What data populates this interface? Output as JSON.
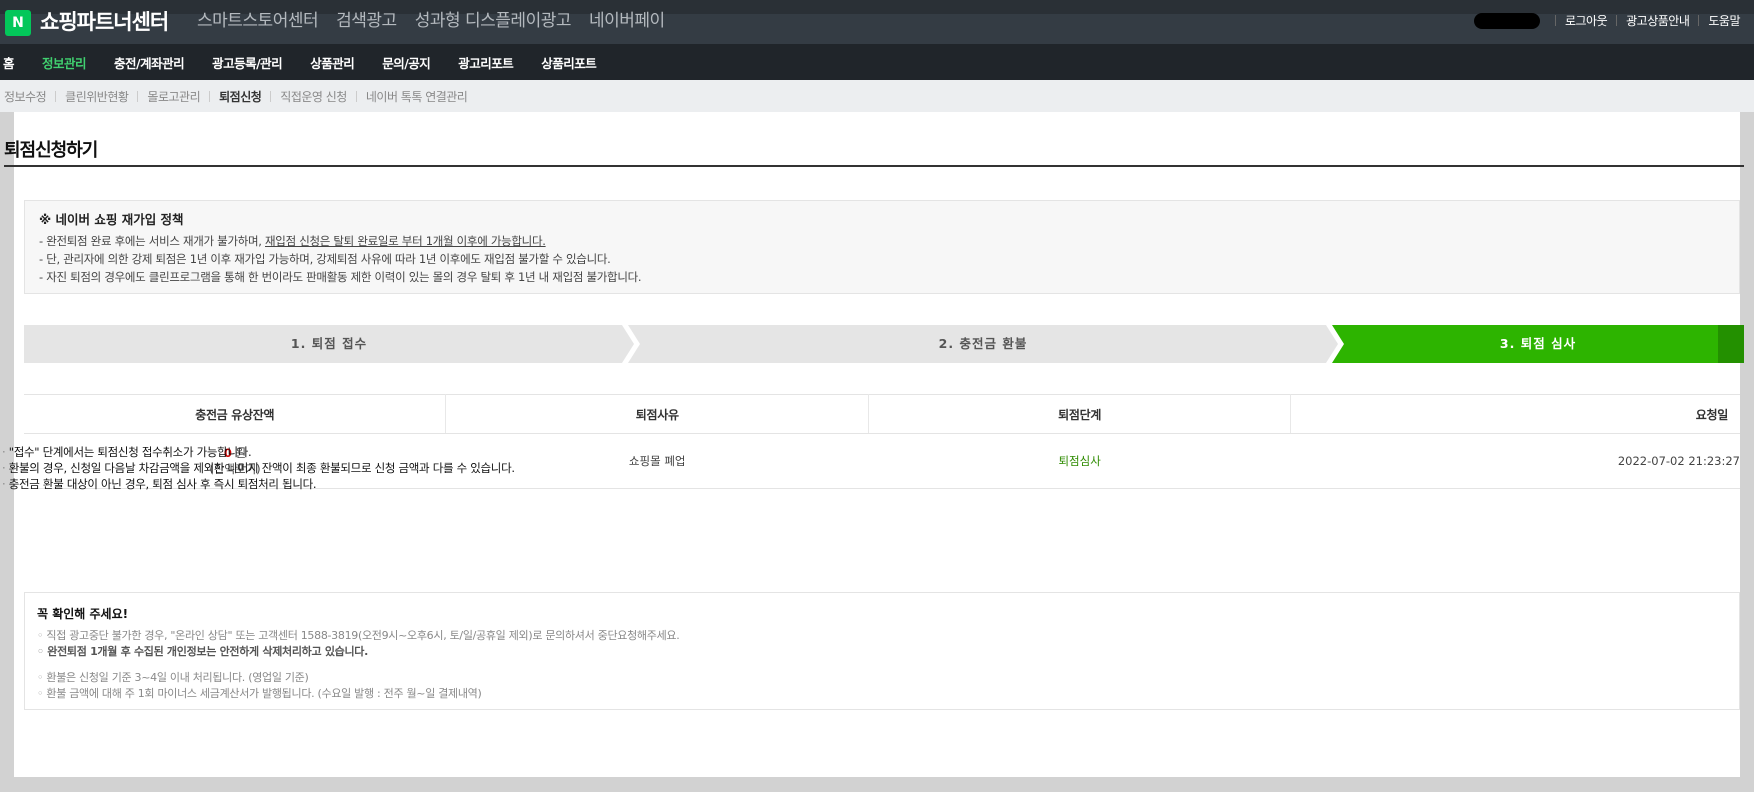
{
  "header": {
    "logo_letter": "N",
    "brand": "쇼핑파트너센터",
    "gnb": [
      "스마트스토어센터",
      "검색광고",
      "성과형 디스플레이광고",
      "네이버페이"
    ],
    "util": [
      "로그아웃",
      "광고상품안내",
      "도움말"
    ]
  },
  "mainnav": {
    "items": [
      "홈",
      "정보관리",
      "충전/계좌관리",
      "광고등록/관리",
      "상품관리",
      "문의/공지",
      "광고리포트",
      "상품리포트"
    ],
    "active_index": 1
  },
  "subnav": {
    "items": [
      "정보수정",
      "클린위반현황",
      "몰로고관리",
      "퇴점신청",
      "직접운영 신청",
      "네이버 톡톡 연결관리"
    ],
    "active_index": 3
  },
  "page": {
    "title": "퇴점신청하기",
    "policy": {
      "heading": "※ 네이버 쇼핑 재가입 정책",
      "line1_prefix": "- 완전퇴점 완료 후에는 서비스 재개가 불가하며, ",
      "line1_underlined": "재입점 신청은 탈퇴 완료일로 부터 1개월 이후에 가능합니다.",
      "line2": "- 단, 관리자에 의한 강제 퇴점은 1년 이후 재가입 가능하며, 강제퇴점 사유에 따라 1년 이후에도 재입점 불가할 수 있습니다.",
      "line3": "- 자진 퇴점의 경우에도 클린프로그램을 통해 한 번이라도 판매활동 제한 이력이 있는 몰의 경우 탈퇴 후 1년 내 재입점 불가합니다."
    },
    "steps": [
      "1. 퇴점 접수",
      "2. 충전금 환불",
      "3. 퇴점 심사"
    ],
    "table": {
      "headers": [
        "충전금 유상잔액",
        "퇴점사유",
        "퇴점단계",
        "요청일"
      ],
      "row": {
        "amount": "0",
        "unit": "원",
        "amount_note": "(잔액포기)",
        "reason": "쇼핑몰 폐업",
        "stage": "퇴점심사",
        "date": "2022-07-02 21:23:27"
      }
    },
    "notes": [
      "\"접수\" 단계에서는 퇴점신청 접수취소가 가능합니다.",
      "환불의 경우, 신청일 다음날 차감금액을 제외한 나머지 잔액이 최종 환불되므로 신청 금액과 다를 수 있습니다.",
      "충전금 환불 대상이 아닌 경우, 퇴점 심사 후 즉시 퇴점처리 됩니다."
    ],
    "confirm": {
      "heading": "꼭 확인해 주세요!",
      "line1": "직접 광고중단 불가한 경우, \"온라인 상담\" 또는 고객센터 1588-3819(오전9시~오후6시, 토/일/공휴일 제외)로 문의하셔서 중단요청해주세요.",
      "line2": "완전퇴점 1개월 후 수집된 개인정보는 안전하게 삭제처리하고 있습니다.",
      "line3": "환불은 신청일 기준 3~4일 이내 처리됩니다. (영업일 기준)",
      "line4": "환불 금액에 대해 주 1회 마이너스 세금계산서가 발행됩니다. (수요일 발행 : 전주 월~일 결제내역)"
    }
  },
  "colors": {
    "accent_green": "#2db400",
    "header_bg": "#343c44",
    "nav_bg": "#20252a",
    "active_nav": "#40d06f"
  }
}
